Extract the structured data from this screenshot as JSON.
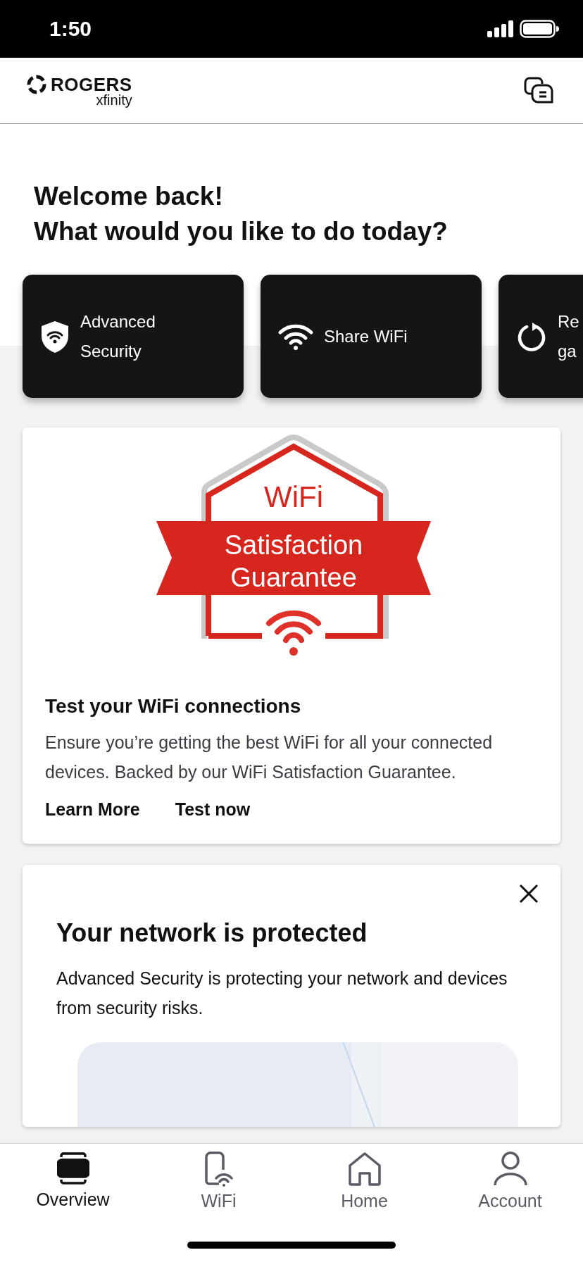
{
  "status_bar": {
    "time": "1:50"
  },
  "header": {
    "brand": "ROGERS",
    "sub_brand": "xfinity"
  },
  "greeting": [
    "Welcome back!",
    "What would you like to do today?"
  ],
  "quick_actions": [
    {
      "kind": "security",
      "lines": [
        "Advanced",
        "Security"
      ]
    },
    {
      "kind": "wifi",
      "lines": [
        "Share WiFi"
      ]
    },
    {
      "kind": "restart",
      "lines": [
        "Re",
        "ga"
      ]
    }
  ],
  "wifi_card": {
    "badge": [
      "WiFi",
      "Satisfaction",
      "Guarantee"
    ],
    "title": "Test your WiFi connections",
    "body": "Ensure you’re getting the best WiFi for all your connected devices. Backed by our WiFi Satisfaction Guarantee.",
    "links": [
      "Learn More",
      "Test now"
    ]
  },
  "security_card": {
    "dismissible": true,
    "title": "Your network is protected",
    "body": "Advanced Security is protecting your network and devices from security risks."
  },
  "tab_bar": [
    {
      "kind": "overview",
      "label": "Overview",
      "selected": true
    },
    {
      "kind": "wifi",
      "label": "WiFi",
      "selected": false
    },
    {
      "kind": "home",
      "label": "Home",
      "selected": false
    },
    {
      "kind": "account",
      "label": "Account",
      "selected": false
    }
  ]
}
